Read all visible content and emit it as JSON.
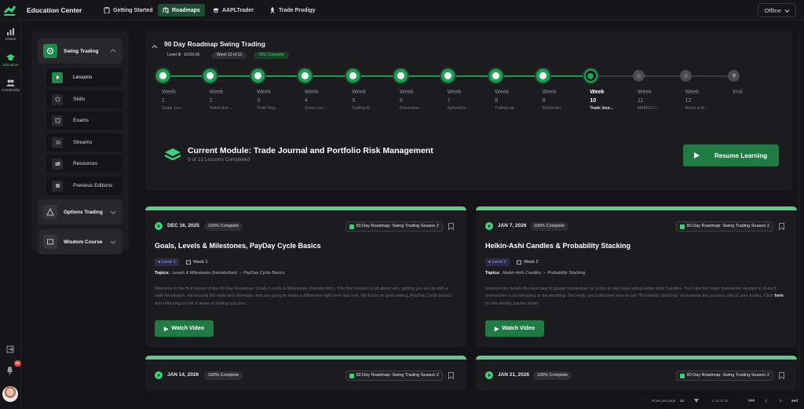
{
  "app": {
    "title": "Education Center",
    "status": "Offline"
  },
  "nav": [
    {
      "label": "Getting Started",
      "icon": "clipboard-icon",
      "active": false
    },
    {
      "label": "Roadmaps",
      "icon": "roadmap-icon",
      "active": true
    },
    {
      "label": "AAPLTrader",
      "icon": "graduation-icon",
      "active": false
    },
    {
      "label": "Trade Prodigy",
      "icon": "rocket-icon",
      "active": false
    }
  ],
  "rail": {
    "items": [
      {
        "label": "Charts"
      },
      {
        "label": "Education"
      },
      {
        "label": "Community"
      }
    ],
    "notification_count": "99"
  },
  "sidebar": {
    "groups": [
      {
        "label": "Swing Trading"
      },
      {
        "label": "Options Trading"
      },
      {
        "label": "Wisdom Course"
      }
    ],
    "items": [
      {
        "label": "Lessons",
        "active": true
      },
      {
        "label": "Skills"
      },
      {
        "label": "Exams"
      },
      {
        "label": "Streams"
      },
      {
        "label": "Resources"
      },
      {
        "label": "Previous Editions"
      }
    ]
  },
  "roadmap": {
    "title": "90 Day Roadmap Swing Trading",
    "level": "Level III - EVOLVE",
    "week_pill": "Week 10 of 12",
    "complete_pill": "75% Complete",
    "progress": 0.75,
    "weeks": [
      {
        "w": "Week",
        "n": "1",
        "name": "Goals, Lev...",
        "state": "done"
      },
      {
        "w": "Week",
        "n": "2",
        "name": "Heikin-Ash...",
        "state": "done"
      },
      {
        "w": "Week",
        "n": "3",
        "name": "Profit Targ...",
        "state": "done"
      },
      {
        "w": "Week",
        "n": "4",
        "name": "Seven Lev...",
        "state": "done"
      },
      {
        "w": "Week",
        "n": "5",
        "name": "Trading M...",
        "state": "done"
      },
      {
        "w": "Week",
        "n": "6",
        "name": "Retraceme...",
        "state": "done"
      },
      {
        "w": "Week",
        "n": "7",
        "name": "Symmetric...",
        "state": "done"
      },
      {
        "w": "Week",
        "n": "8",
        "name": "Trading wit...",
        "state": "done"
      },
      {
        "w": "Week",
        "n": "9",
        "name": "Backtestin...",
        "state": "done"
      },
      {
        "w": "Week",
        "n": "10",
        "name": "Trade Jour...",
        "state": "current"
      },
      {
        "w": "Week",
        "n": "11",
        "name": "MARKET I...",
        "state": "todo"
      },
      {
        "w": "Week",
        "n": "12",
        "name": "Rocks in th...",
        "state": "todo"
      },
      {
        "w": "End",
        "n": "",
        "name": "",
        "state": "end"
      }
    ],
    "module_title": "Current Module: Trade Journal and Portfolio Risk Management",
    "module_sub": "9 of 12 Lessons Completed",
    "resume_label": "Resume Learning"
  },
  "cards": [
    {
      "date": "DEC 16, 2025",
      "complete": "100% Complete",
      "tag": "90 Day Roadmap: Swing Trading Season 2",
      "title": "Goals, Levels & Milestones, PayDay Cycle Basics",
      "level": "Level 1",
      "week": "Week 1",
      "topics_label": "Topics:",
      "topic1": "Levels & Milestones (Introduction)",
      "topic2": "PayDay Cycle Basics",
      "desc": "Welcome to the first lesson of the 90 Day Roadmap: Goals, Levels & Milestones (Introduction). This first session is all about you, getting you set up with a solid foundation, introducing the tools and strategies that are going to make a difference right from day one. We focus on goal setting, PayDay Cycle basics and reflecting on the 9 areas of trading success.",
      "watch": "Watch Video"
    },
    {
      "date": "JAN 7, 2026",
      "complete": "100% Complete",
      "tag": "90 Day Roadmap: Swing Trading Season 2",
      "title": "Heikin-Ashi Candles & Probability Stacking",
      "level": "Level 1",
      "week": "Week 2",
      "topics_label": "Topics:",
      "topic1": "Heikin Ashi Candles",
      "topic2": "Probability Stacking",
      "desc_a": "Session two details the best way to gauge momentum on a day to day basis using Heikin Ashi Candles. You'll get the exact framework needed to know if momentum is accelerating or decelerating. Secondly, you'll discover how to use \"Probability Stacking\" to increase the success rate of your trades. Click ",
      "desc_link": "here",
      "desc_b": " for the weekly tracker sheet.",
      "watch": "Watch Video"
    },
    {
      "date": "JAN 14, 2026",
      "complete": "100% Complete",
      "tag": "90 Day Roadmap: Swing Trading Season 2"
    },
    {
      "date": "JAN 21, 2026",
      "complete": "100% Complete",
      "tag": "90 Day Roadmap: Swing Trading Season 2"
    }
  ],
  "pager": {
    "rows_label": "Rows per page:",
    "rows_value": "20",
    "range": "1–12 of 12"
  },
  "colors": {
    "accent": "#1f9d55",
    "accent_dark": "#1f7a44",
    "card_bar": "#5fc98c",
    "bg": "#141416",
    "panel": "#1c1c1f"
  }
}
